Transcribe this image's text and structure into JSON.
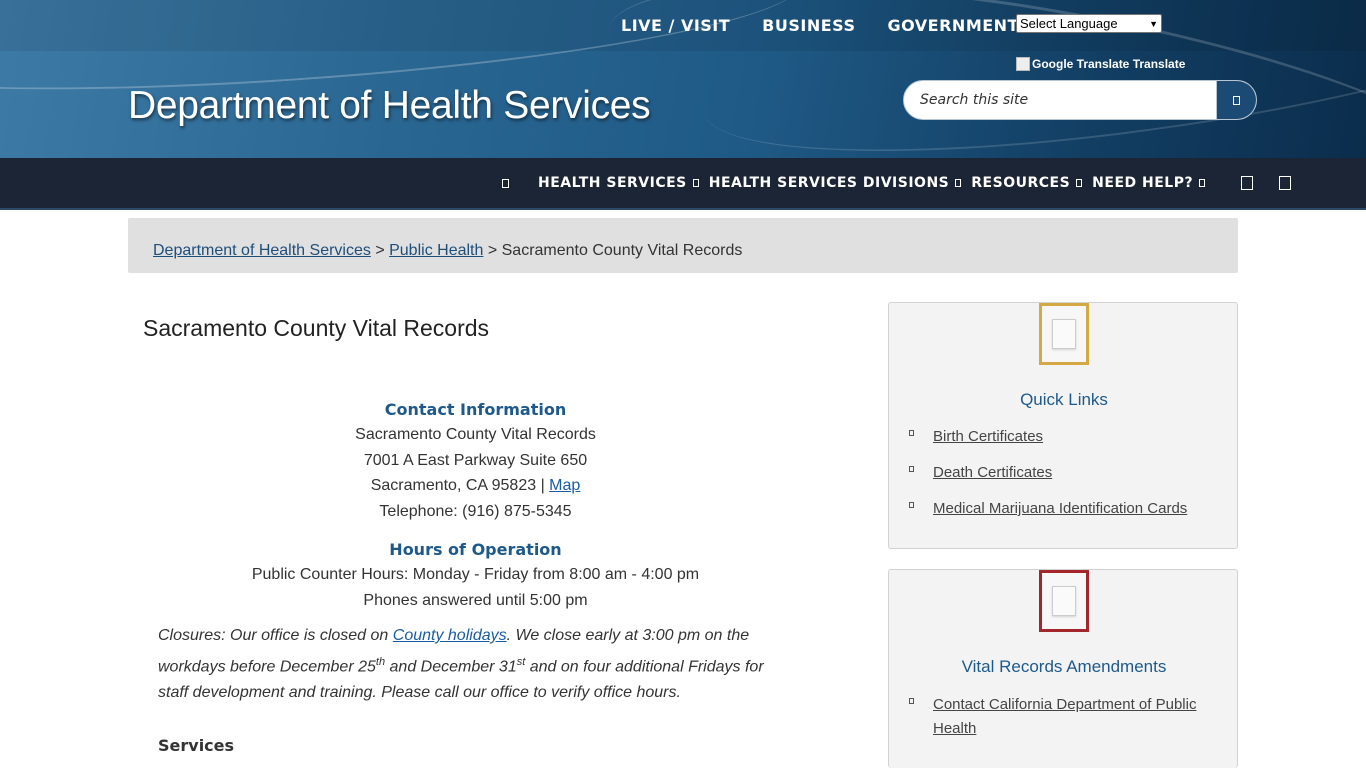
{
  "header": {
    "top_nav": [
      "LIVE / VISIT",
      "BUSINESS",
      "GOVERNMENT"
    ],
    "language_select": "Select Language",
    "google_translate": "Google Translate Translate",
    "site_title": "Department of Health Services",
    "search_placeholder": "Search this site"
  },
  "main_nav": {
    "items": [
      "HEALTH SERVICES",
      "HEALTH SERVICES DIVISIONS",
      "RESOURCES",
      "NEED HELP?"
    ]
  },
  "breadcrumb": {
    "link1": "Department of Health Services",
    "sep1": " > ",
    "link2": "Public Health",
    "sep2": " > ",
    "current": "Sacramento County Vital Records"
  },
  "page": {
    "title": "Sacramento County Vital Records",
    "contact_heading": "Contact Information",
    "contact_name": "Sacramento County Vital Records",
    "address1": "7001 A East Parkway Suite 650",
    "address2": "Sacramento, CA 95823 | ",
    "map_link": "Map",
    "telephone": "Telephone: (916) 875-5345",
    "hours_heading": "Hours of Operation",
    "counter_hours": "Public Counter Hours:  Monday - Friday from 8:00 am - 4:00 pm",
    "phone_hours": "Phones answered until 5:00 pm",
    "closures_a": "Closures:  Our office is closed on ",
    "closures_link": "County holidays",
    "closures_b": ". We close early at 3:00 pm on the workdays before December 25",
    "sup1": "th",
    "closures_c": " and December 31",
    "sup2": "st",
    "closures_d": " and on four additional Fridays for staff development and training. Please call our office to verify office hours.",
    "services_heading": "Services"
  },
  "sidebar": {
    "quick_links": {
      "title": "Quick Links",
      "accent": "#d4a843",
      "items": [
        "Birth Certificates",
        "Death Certificates",
        "Medical Marijuana Identification Cards"
      ]
    },
    "amendments": {
      "title": "Vital Records Amendments",
      "accent": "#a3262a",
      "items": [
        "Contact California Department of Public Health"
      ]
    }
  }
}
